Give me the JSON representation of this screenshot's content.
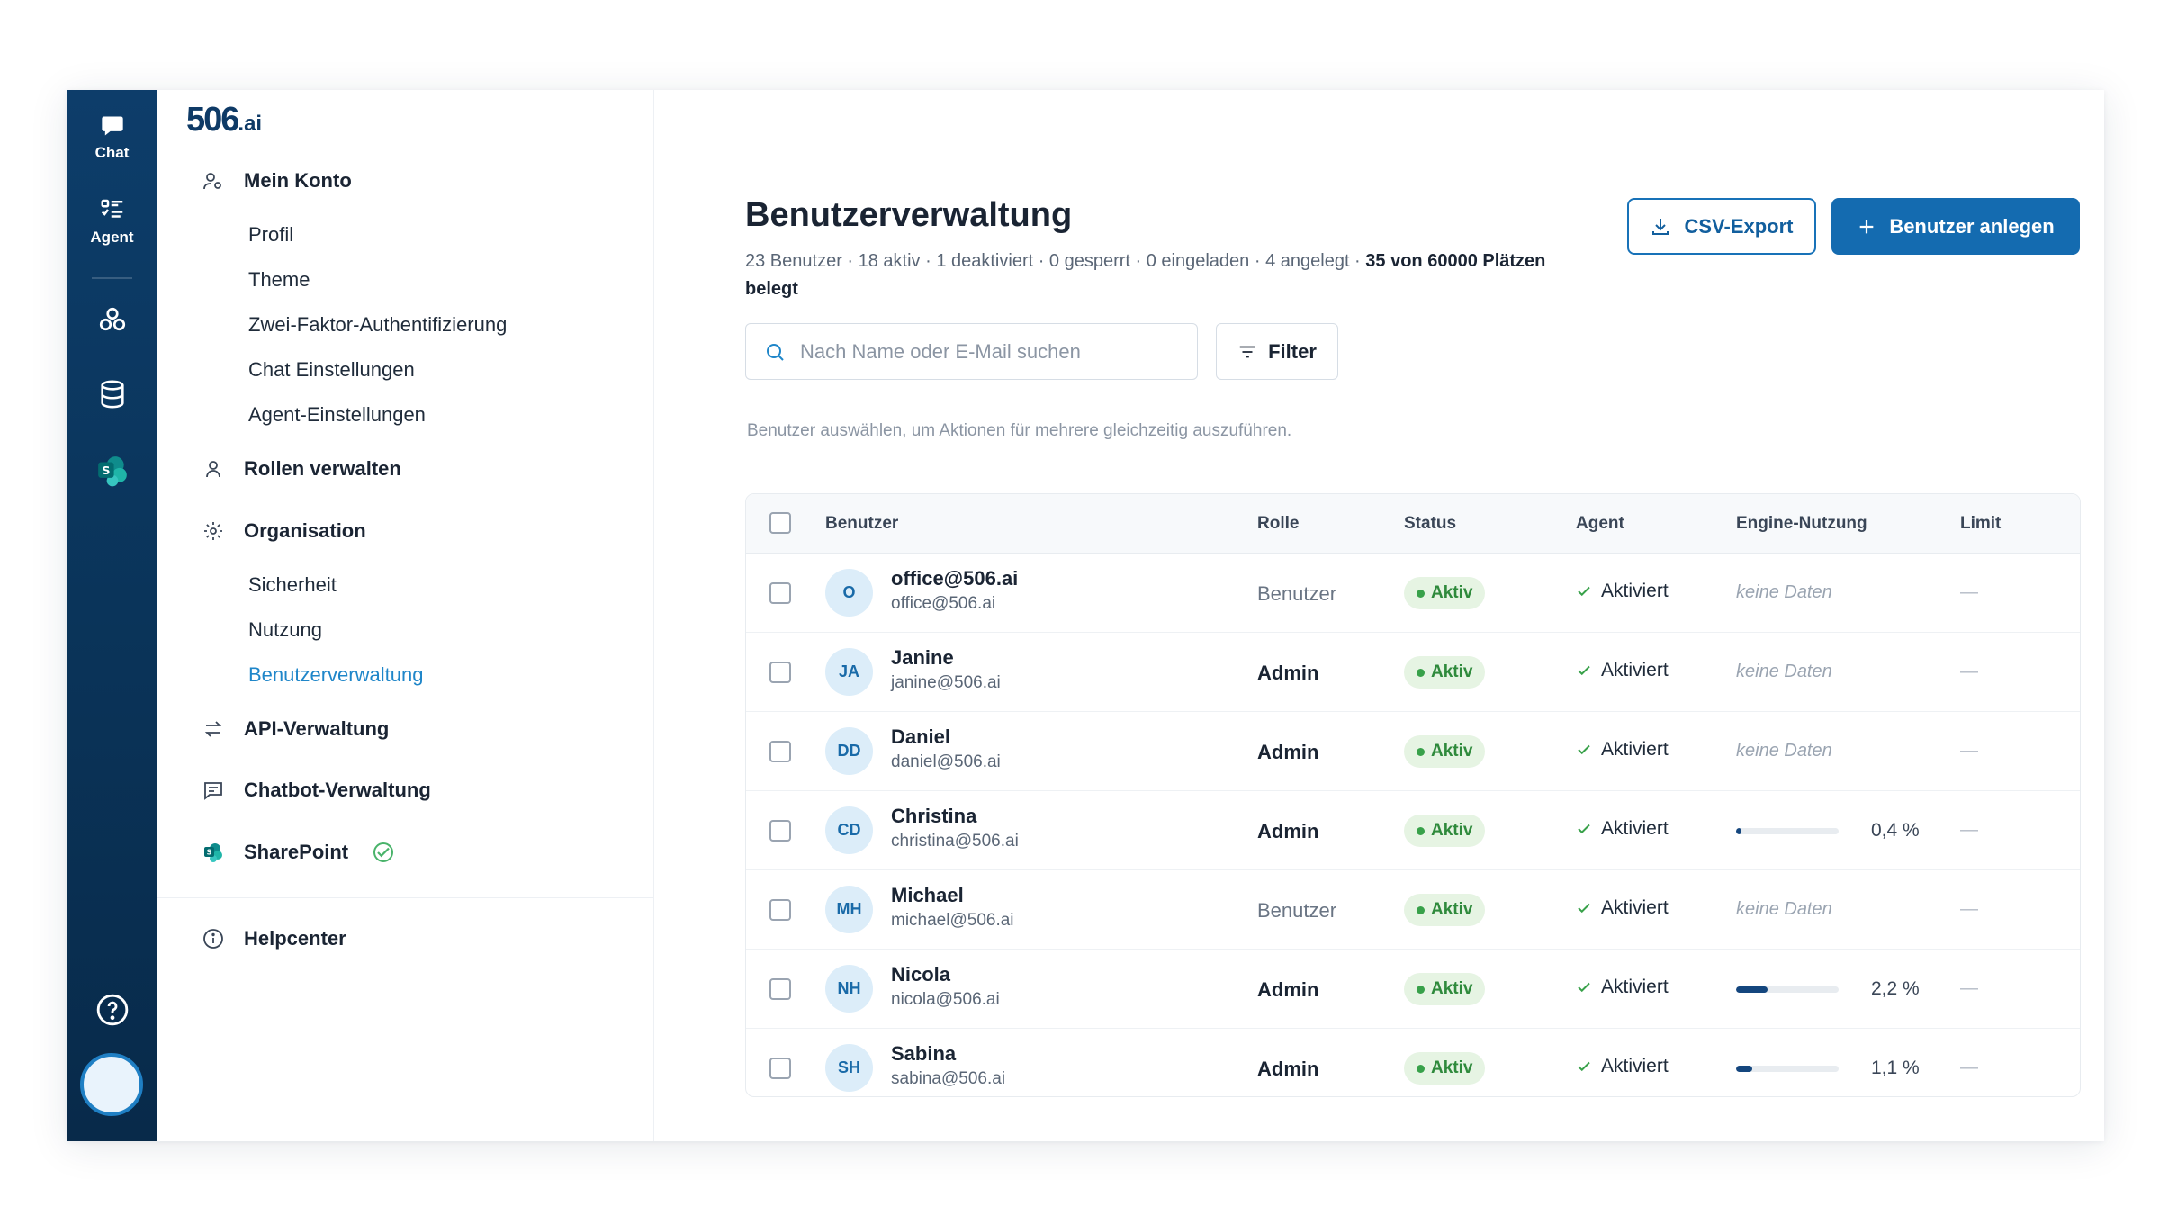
{
  "rail": {
    "chat_label": "Chat",
    "agent_label": "Agent"
  },
  "brand": {
    "logo_main": "506",
    "logo_suffix": ".ai"
  },
  "nav": {
    "my_account": "Mein Konto",
    "my_account_items": [
      "Profil",
      "Theme",
      "Zwei-Faktor-Authentifizierung",
      "Chat Einstellungen",
      "Agent-Einstellungen"
    ],
    "roles": "Rollen verwalten",
    "organisation": "Organisation",
    "organisation_items": [
      "Sicherheit",
      "Nutzung",
      "Benutzerverwaltung"
    ],
    "active_item": "Benutzerverwaltung",
    "api": "API-Verwaltung",
    "chatbot": "Chatbot-Verwaltung",
    "sharepoint": "SharePoint",
    "helpcenter": "Helpcenter"
  },
  "header": {
    "title": "Benutzerverwaltung",
    "summary": "23 Benutzer · 18 aktiv · 1 deaktiviert · 0 gesperrt · 0 eingeladen · 4 angelegt  · ",
    "seats": "35 von 60000 Plätzen belegt",
    "csv_label": "CSV-Export",
    "add_label": "Benutzer anlegen"
  },
  "search": {
    "placeholder": "Nach Name oder E-Mail suchen",
    "value": ""
  },
  "filter_label": "Filter",
  "hint": "Benutzer auswählen, um Aktionen für mehrere gleichzeitig auszuführen.",
  "table": {
    "columns": [
      "Benutzer",
      "Rolle",
      "Status",
      "Agent",
      "Engine-Nutzung",
      "Limit"
    ],
    "no_data": "keine Daten",
    "limit_placeholder": "—",
    "rows": [
      {
        "initials": "O",
        "name": "office@506.ai",
        "email": "office@506.ai",
        "role": "Benutzer",
        "status": "Aktiv",
        "agent": "Aktiviert",
        "usage": null,
        "usage_label": "",
        "limit": "—"
      },
      {
        "initials": "JA",
        "name": "Janine",
        "email": "janine@506.ai",
        "role": "Admin",
        "status": "Aktiv",
        "agent": "Aktiviert",
        "usage": null,
        "usage_label": "",
        "limit": "—"
      },
      {
        "initials": "DD",
        "name": "Daniel",
        "email": "daniel@506.ai",
        "role": "Admin",
        "status": "Aktiv",
        "agent": "Aktiviert",
        "usage": null,
        "usage_label": "",
        "limit": "—"
      },
      {
        "initials": "CD",
        "name": "Christina",
        "email": "christina@506.ai",
        "role": "Admin",
        "status": "Aktiv",
        "agent": "Aktiviert",
        "usage": 0.4,
        "usage_label": "0,4 %",
        "limit": "—"
      },
      {
        "initials": "MH",
        "name": "Michael",
        "email": "michael@506.ai",
        "role": "Benutzer",
        "status": "Aktiv",
        "agent": "Aktiviert",
        "usage": null,
        "usage_label": "",
        "limit": "—"
      },
      {
        "initials": "NH",
        "name": "Nicola",
        "email": "nicola@506.ai",
        "role": "Admin",
        "status": "Aktiv",
        "agent": "Aktiviert",
        "usage": 2.2,
        "usage_label": "2,2 %",
        "limit": "—"
      },
      {
        "initials": "SH",
        "name": "Sabina",
        "email": "sabina@506.ai",
        "role": "Admin",
        "status": "Aktiv",
        "agent": "Aktiviert",
        "usage": 1.1,
        "usage_label": "1,1 %",
        "limit": "—"
      }
    ]
  },
  "colors": {
    "accent": "#146bb0",
    "rail": "#0a3358",
    "active_nav": "#1f86c9",
    "status_green": "#2f8a3c"
  }
}
